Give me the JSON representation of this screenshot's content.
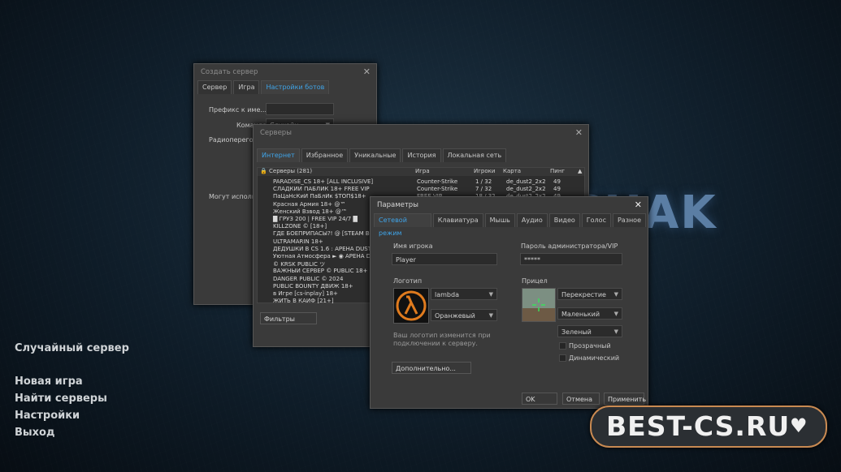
{
  "logo_text": "CHAK",
  "menu": {
    "random_server": "Случайный сервер",
    "new_game": "Новая игра",
    "find_servers": "Найти серверы",
    "settings": "Настройки",
    "exit": "Выход"
  },
  "create_server": {
    "title": "Создать сервер",
    "tabs": [
      "Сервер",
      "Игра",
      "Настройки ботов"
    ],
    "prefix_label": "Префикс к име...",
    "team_label": "Команда",
    "team_value": "Случайн...",
    "radio_label": "Радиоперего...",
    "can_use_label": "Могут исполь..."
  },
  "servers": {
    "title": "Серверы",
    "tabs": [
      "Интернет",
      "Избранное",
      "Уникальные",
      "История",
      "Локальная сеть"
    ],
    "columns": {
      "name": "Серверы (281)",
      "game": "Игра",
      "players": "Игроки",
      "map": "Карта",
      "ping": "Пинг"
    },
    "rows": [
      {
        "name": "PARADISE_CS 18+ [ALL INCLUSIVE]",
        "game": "Counter-Strike",
        "players": "1 / 32",
        "map": "de_dust2_2x2",
        "ping": "49"
      },
      {
        "name": "СЛАДКИЙ ПАБЛИК 18+ FREE VIP",
        "game": "Counter-Strike",
        "players": "7 / 32",
        "map": "de_dust2_2x2",
        "ping": "49"
      },
      {
        "name": "ПаЦаНсКиЙ ПаБлИк $ТОП$18+",
        "game": "FREE VIP",
        "players": "18 / 32",
        "map": "de_dust2_2x2",
        "ping": "49"
      },
      {
        "name": "Красная Армия 18+ @™",
        "game": "",
        "players": "",
        "map": "",
        "ping": ""
      },
      {
        "name": "Женский Взвод 18+ @™",
        "game": "",
        "players": "",
        "map": "",
        "ping": ""
      },
      {
        "name": "█ ГРУЗ 200 | FREE VIP 24/7 █",
        "game": "",
        "players": "",
        "map": "",
        "ping": ""
      },
      {
        "name": "KILLZONE © [18+]",
        "game": "",
        "players": "",
        "map": "",
        "ping": ""
      },
      {
        "name": "ГДЕ БОЕПРИПАСЫ?! @ [STEAM BONUS]",
        "game": "",
        "players": "",
        "map": "",
        "ping": ""
      },
      {
        "name": "ULTRAMARIN 18+",
        "game": "",
        "players": "",
        "map": "",
        "ping": ""
      },
      {
        "name": "ДЕДУШКИ В CS 1.6 : АРЕНА DUST2 @™",
        "game": "",
        "players": "",
        "map": "",
        "ping": ""
      },
      {
        "name": "Уютная Атмосфера ► ◉ АРЕНА DUST2",
        "game": "",
        "players": "",
        "map": "",
        "ping": ""
      },
      {
        "name": "© KRSK PUBLIC ツ",
        "game": "",
        "players": "",
        "map": "",
        "ping": ""
      },
      {
        "name": "ВАЖНЫЙ СЕРВЕР © PUBLIC 18+",
        "game": "",
        "players": "",
        "map": "",
        "ping": ""
      },
      {
        "name": "DANGER PUBLIC © 2024",
        "game": "",
        "players": "",
        "map": "",
        "ping": ""
      },
      {
        "name": "PUBLIC BOUNTY ДВИЖ 18+",
        "game": "",
        "players": "",
        "map": "",
        "ping": ""
      },
      {
        "name": "в Игре [cs-inplay] 18+",
        "game": "",
        "players": "",
        "map": "",
        "ping": ""
      },
      {
        "name": "ЖИТЬ В КАЙФ [21+]",
        "game": "",
        "players": "",
        "map": "",
        "ping": ""
      }
    ],
    "filters_button": "Фильтры"
  },
  "params": {
    "title": "Параметры",
    "tabs": [
      "Сетевой режим",
      "Клавиатура",
      "Мышь",
      "Аудио",
      "Видео",
      "Голос",
      "Разное"
    ],
    "player_name_label": "Имя игрока",
    "player_name_value": "Player",
    "admin_pass_label": "Пароль администратора/VIP",
    "admin_pass_value": "*****",
    "logo_label": "Логотип",
    "logo_value": "lambda",
    "logo_color": "Оранжевый",
    "logo_note": "Ваш логотип изменится при подключении к серверу.",
    "crosshair_label": "Прицел",
    "crosshair_type": "Перекрестие",
    "crosshair_size": "Маленький",
    "crosshair_color": "Зеленый",
    "transparent_label": "Прозрачный",
    "dynamic_label": "Динамический",
    "advanced_button": "Дополнительно...",
    "ok_button": "OK",
    "cancel_button": "Отмена",
    "apply_button": "Применить"
  },
  "badge": {
    "text": "BEST-CS.RU",
    "heart": "♥"
  },
  "colors": {
    "accent_tab": "#3fa4e8",
    "badge_border": "#c98a52",
    "lambda_orange": "#e07b1e"
  }
}
